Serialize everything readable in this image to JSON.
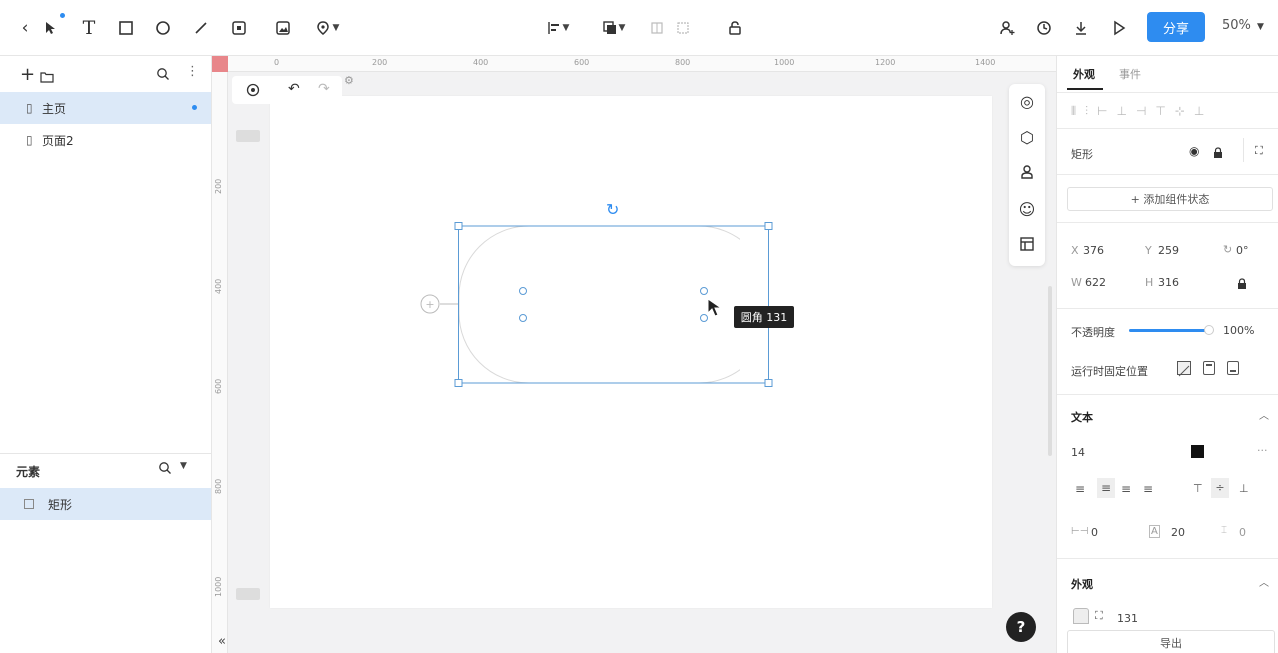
{
  "toolbar": {
    "share_label": "分享",
    "zoom_label": "50%"
  },
  "leftpanel": {
    "pages": [
      {
        "label": "主页"
      },
      {
        "label": "页面2"
      }
    ],
    "elements_title": "元素",
    "elements": [
      {
        "label": "矩形"
      }
    ]
  },
  "ruler": {
    "top": [
      "0",
      "200",
      "400",
      "600",
      "800",
      "1000",
      "1200",
      "1400"
    ],
    "left": [
      "200",
      "400",
      "600",
      "800",
      "1000"
    ]
  },
  "canvas": {
    "tooltip": "圆角 131"
  },
  "rightpanel": {
    "tabs": [
      "外观",
      "事件"
    ],
    "component_name": "矩形",
    "add_state_label": "+ 添加组件状态",
    "x_label": "X",
    "x_value": "376",
    "y_label": "Y",
    "y_value": "259",
    "rotation_value": "0°",
    "w_label": "W",
    "w_value": "622",
    "h_label": "H",
    "h_value": "316",
    "opacity_label": "不透明度",
    "opacity_value": "100%",
    "opacity_fraction": 1.0,
    "fixed_label": "运行时固定位置",
    "text_section": "文本",
    "font_size": "14",
    "more": "···",
    "letter_spacing": "0",
    "line_height": "20",
    "para_spacing": "0",
    "appearance_section": "外观",
    "radius_value": "131",
    "export_label": "导出"
  },
  "colors": {
    "accent": "#2e8cf0",
    "selection_bg": "#dce9f8",
    "ruler_marker": "#e8868a"
  }
}
